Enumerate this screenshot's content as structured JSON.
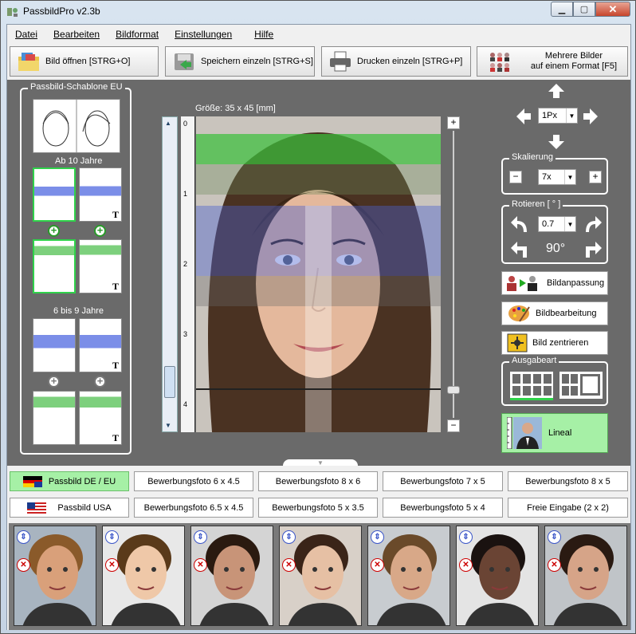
{
  "window": {
    "title": "PassbildPro  v2.3b",
    "controls": [
      "minimize",
      "maximize",
      "close"
    ]
  },
  "menu": [
    "Datei",
    "Bearbeiten",
    "Bildformat",
    "Einstellungen",
    "Hilfe"
  ],
  "toolbar": {
    "open": "Bild öffnen [STRG+O]",
    "save": "Speichern einzeln [STRG+S]",
    "print": "Drucken einzeln [STRG+P]",
    "multi_line1": "Mehrere Bilder",
    "multi_line2": "auf einem Format [F5]"
  },
  "template_panel": {
    "title": "Passbild-Schablone EU",
    "section1": "Ab 10 Jahre",
    "section2": "6 bis 9 Jahre"
  },
  "canvas": {
    "size_label": "Größe: 35 x 45 [mm]",
    "ruler_marks": [
      "0",
      "1",
      "2",
      "3",
      "4"
    ],
    "zoom_plus": "+",
    "zoom_minus": "−"
  },
  "controls": {
    "move_step": "1Px",
    "scale_title": "Skalierung",
    "scale_value": "7x",
    "rotate_title": "Rotieren [ ° ]",
    "rotate_value": "0.7",
    "rotate_90": "90°",
    "adjust": "Bildanpassung",
    "edit": "Bildbearbeitung",
    "center": "Bild zentrieren",
    "output_title": "Ausgabeart",
    "ruler": "Lineal"
  },
  "formats_row1": [
    "Passbild DE / EU",
    "Bewerbungsfoto 6 x 4.5",
    "Bewerbungsfoto 8 x 6",
    "Bewerbungsfoto 7 x 5",
    "Bewerbungsfoto 8 x 5"
  ],
  "formats_row2": [
    "Passbild USA",
    "Bewerbungsfoto 6.5 x 4.5",
    "Bewerbungsfoto 5 x 3.5",
    "Bewerbungsfoto 5 x 4",
    "Freie Eingabe (2 x 2)"
  ],
  "colors": {
    "selected": "#a6f0a6",
    "panel_bg": "#6a6a6a",
    "green_band": "#3cbf3c",
    "blue_band": "#4a5fd0"
  },
  "photo_strip_count": 7
}
